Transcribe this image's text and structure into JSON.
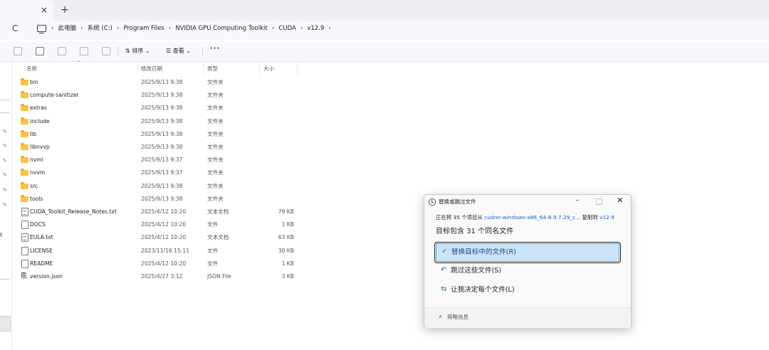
{
  "tab": {
    "close_glyph": "×",
    "new_tab_glyph": "+"
  },
  "address": {
    "refresh_glyph": "C",
    "crumbs": [
      "此电脑",
      "系统 (C:)",
      "Program Files",
      "NVIDIA GPU Computing Toolkit",
      "CUDA",
      "v12.9"
    ],
    "sep": "›"
  },
  "command_bar": {
    "sort_label": "⇅ 排序 ⌄",
    "view_label": "☰ 查看 ⌄",
    "more_label": "···"
  },
  "nav": {
    "side_letter": "t"
  },
  "columns": {
    "name": "名称",
    "date": "修改日期",
    "type": "类型",
    "size": "大小"
  },
  "files": [
    {
      "name": "bin",
      "date": "2025/9/13 9:38",
      "type": "文件夹",
      "size": "",
      "kind": "folder"
    },
    {
      "name": "compute-sanitizer",
      "date": "2025/9/13 9:38",
      "type": "文件夹",
      "size": "",
      "kind": "folder"
    },
    {
      "name": "extras",
      "date": "2025/9/13 9:38",
      "type": "文件夹",
      "size": "",
      "kind": "folder"
    },
    {
      "name": "include",
      "date": "2025/9/13 9:38",
      "type": "文件夹",
      "size": "",
      "kind": "folder"
    },
    {
      "name": "lib",
      "date": "2025/9/13 9:38",
      "type": "文件夹",
      "size": "",
      "kind": "folder"
    },
    {
      "name": "libnvvp",
      "date": "2025/9/13 9:38",
      "type": "文件夹",
      "size": "",
      "kind": "folder"
    },
    {
      "name": "nvml",
      "date": "2025/9/13 9:37",
      "type": "文件夹",
      "size": "",
      "kind": "folder"
    },
    {
      "name": "nvvm",
      "date": "2025/9/13 9:37",
      "type": "文件夹",
      "size": "",
      "kind": "folder"
    },
    {
      "name": "src",
      "date": "2025/9/13 9:38",
      "type": "文件夹",
      "size": "",
      "kind": "folder"
    },
    {
      "name": "tools",
      "date": "2025/9/13 9:38",
      "type": "文件夹",
      "size": "",
      "kind": "folder"
    },
    {
      "name": "CUDA_Toolkit_Release_Notes.txt",
      "date": "2025/4/12 10:20",
      "type": "文本文档",
      "size": "79 KB",
      "kind": "txt"
    },
    {
      "name": "DOCS",
      "date": "2025/4/12 10:20",
      "type": "文件",
      "size": "1 KB",
      "kind": "file"
    },
    {
      "name": "EULA.txt",
      "date": "2025/4/12 10:20",
      "type": "文本文档",
      "size": "63 KB",
      "kind": "txt"
    },
    {
      "name": "LICENSE",
      "date": "2023/11/16 15:11",
      "type": "文件",
      "size": "30 KB",
      "kind": "file"
    },
    {
      "name": "README",
      "date": "2025/4/12 10:20",
      "type": "文件",
      "size": "1 KB",
      "kind": "file"
    },
    {
      "name": "version.json",
      "date": "2025/4/27 3:12",
      "type": "JSON File",
      "size": "3 KB",
      "kind": "json"
    }
  ],
  "dialog": {
    "title": "替换或跳过文件",
    "minimize_glyph": "–",
    "close_glyph": "✕",
    "progress_prefix": "正在将 35 个项目从 ",
    "source": "cudnn-windows-x86_64-8.9.7.29_c...",
    "progress_middle": " 复制到 ",
    "destination": "v12.9",
    "heading": "目标包含 31 个同名文件",
    "option_replace": "替换目标中的文件(R)",
    "option_skip": "跳过这些文件(S)",
    "option_decide": "让我决定每个文件(L)",
    "replace_icon": "✓",
    "skip_icon": "↶",
    "decide_icon": "⇆",
    "footer_caret": "∧",
    "footer_label": "简略信息"
  }
}
